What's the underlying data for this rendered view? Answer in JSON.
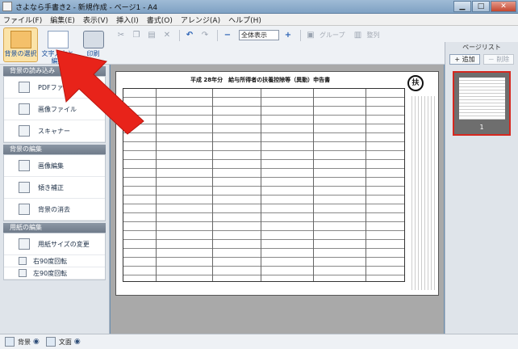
{
  "window": {
    "title": "さよなら手書き2 - 新規作成 - ページ1 - A4"
  },
  "window_controls": {
    "minimize": "▁",
    "maximize": "□",
    "close": "✕"
  },
  "menu": [
    "ファイル(F)",
    "編集(E)",
    "表示(V)",
    "挿入(I)",
    "書式(O)",
    "アレンジ(A)",
    "ヘルプ(H)"
  ],
  "toolbar": {
    "background_label": "背景の選択",
    "text_label": "文字入力と編集",
    "print_label": "印刷",
    "zoom_value": "全体表示",
    "group_label": "グループ",
    "order_label": "整列"
  },
  "sidebar": {
    "load_header": "背景の読み込み",
    "load_items": [
      "PDFファイル",
      "画像ファイル",
      "スキャナー"
    ],
    "edit_header": "背景の編集",
    "edit_items": [
      "画像編集",
      "傾き補正",
      "背景の消去"
    ],
    "paper_header": "用紙の編集",
    "paper_items": [
      "用紙サイズの変更"
    ],
    "rotate_items": [
      "右90度回転",
      "左90度回転"
    ]
  },
  "document": {
    "title": "平成 28年分　給与所得者の扶養控除等（異動）申告書",
    "stamp": "扶"
  },
  "page_list": {
    "title": "ページリスト",
    "add_label": "+ 追加",
    "delete_label": "－ 削除",
    "thumb_number": "1"
  },
  "statusbar": {
    "background_label": "背景",
    "text_label": "文面"
  },
  "colors": {
    "accent": "#d6281f",
    "active_button": "#fbe3a8",
    "arrow": "#e8231a"
  }
}
